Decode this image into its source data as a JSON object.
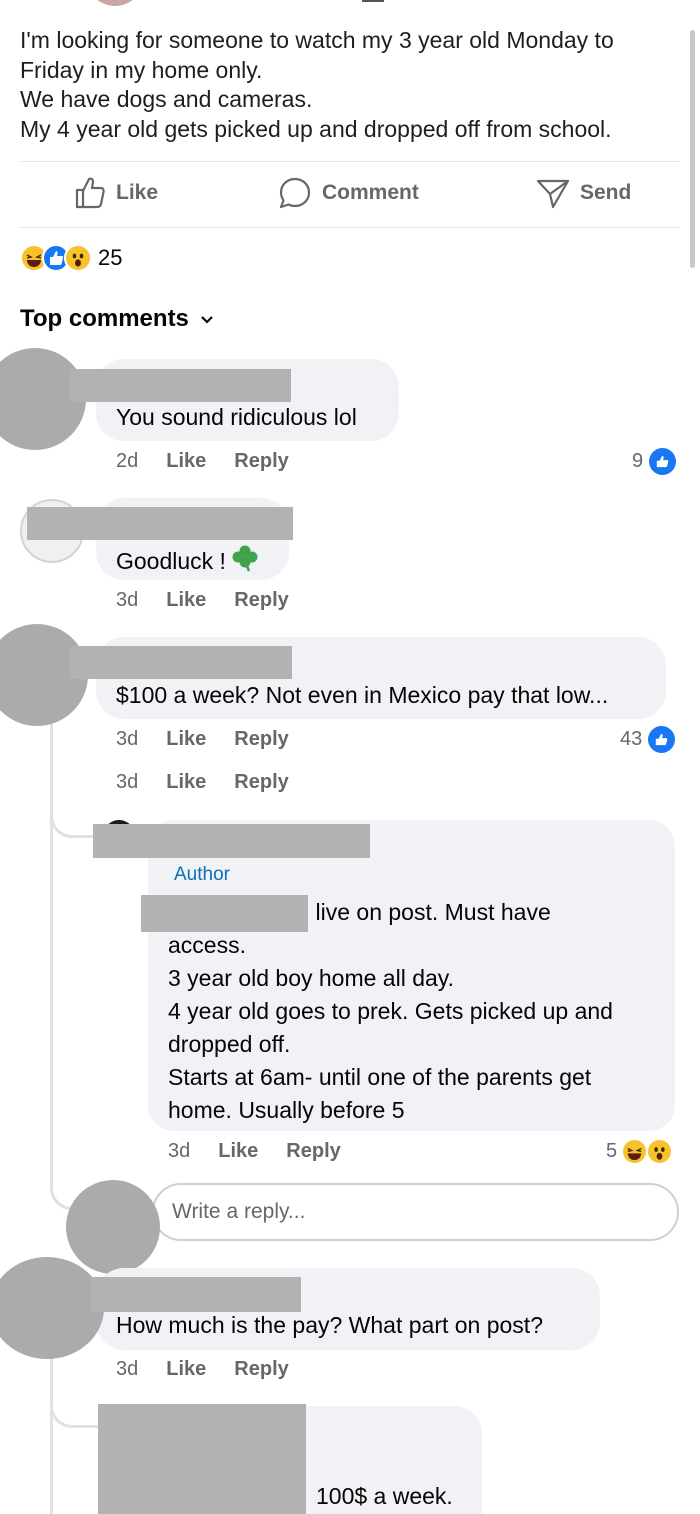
{
  "post": {
    "lines": [
      "I'm looking for someone to watch my 3 year old Monday to",
      "Friday in my home only.",
      "We have dogs and cameras.",
      "My 4 year old gets picked up and dropped off from school."
    ]
  },
  "actions": {
    "like_label": "Like",
    "comment_label": "Comment",
    "send_label": "Send"
  },
  "reactions": {
    "icons": [
      "laughing-emoji-icon",
      "like-reaction-icon",
      "wow-emoji-icon"
    ],
    "count": "25"
  },
  "sort": {
    "label": "Top comments"
  },
  "comments": [
    {
      "text": "You sound ridiculous lol",
      "time": "2d",
      "like": "Like",
      "reply": "Reply",
      "reaction_count": "9"
    },
    {
      "text": "Goodluck !",
      "emoji": "four-leaf-clover-icon",
      "time": "3d",
      "like": "Like",
      "reply": "Reply"
    },
    {
      "text": "$100 a week? Not even in Mexico pay that low...",
      "time": "3d",
      "like": "Like",
      "reply": "Reply",
      "reaction_count": "43",
      "extra_time": "3d",
      "extra_like": "Like",
      "extra_reply": "Reply"
    },
    {
      "text": "How much is the pay? What part on post?",
      "time": "3d",
      "like": "Like",
      "reply": "Reply"
    }
  ],
  "author_reply": {
    "badge": "Author",
    "lines": [
      "l live on post. Must have",
      "access.",
      "3 year old boy home all day.",
      "4 year old goes to prek. Gets picked up and",
      "dropped off.",
      "Starts at 6am- until one of the parents get",
      "home. Usually before 5"
    ],
    "time": "3d",
    "like": "Like",
    "reply": "Reply",
    "reaction_count": "5"
  },
  "reply_box": {
    "placeholder": "Write a reply..."
  },
  "last_reply": {
    "text": "100$ a week."
  },
  "colors": {
    "accent": "#1877f2",
    "bubble": "#f0f2f5",
    "meta": "#65676b",
    "author": "#0a6fb5"
  }
}
